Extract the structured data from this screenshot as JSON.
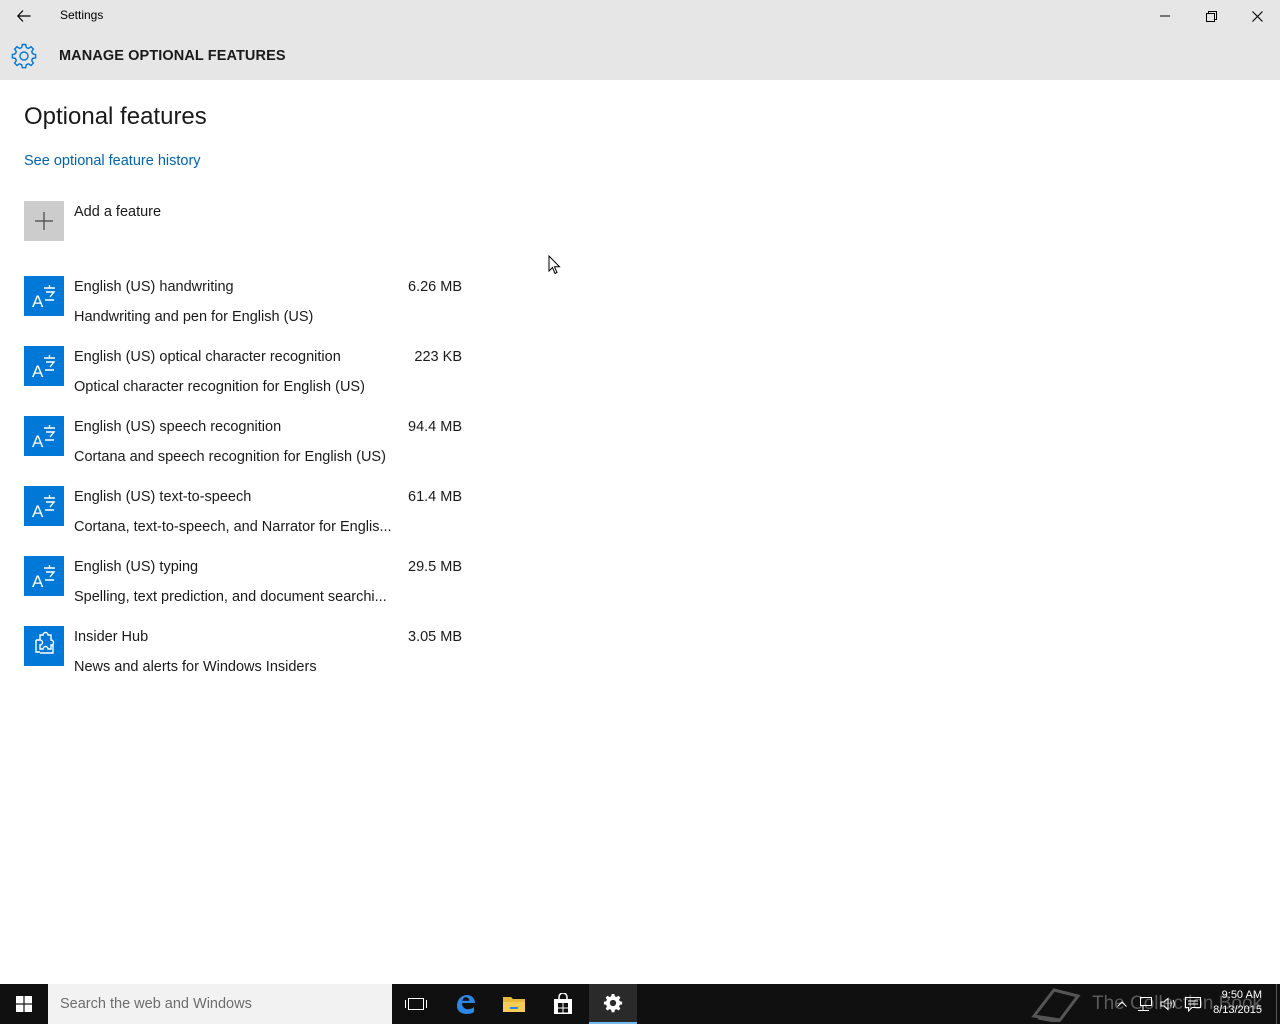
{
  "window": {
    "title": "Settings",
    "back_icon": "back-arrow-icon",
    "controls": [
      "minimize-icon",
      "restore-icon",
      "close-icon"
    ]
  },
  "header": {
    "title": "MANAGE OPTIONAL FEATURES",
    "icon": "gear-icon",
    "accent": "#0078d7"
  },
  "main": {
    "page_title": "Optional features",
    "history_link": "See optional feature history",
    "add_feature_label": "Add a feature",
    "link_color": "#0063b1",
    "features": [
      {
        "name": "English (US) handwriting",
        "description": "Handwriting and pen for English (US)",
        "size": "6.26 MB",
        "icon": "language-icon"
      },
      {
        "name": "English (US) optical character recognition",
        "description": "Optical character recognition for English (US)",
        "size": "223 KB",
        "icon": "language-icon"
      },
      {
        "name": "English (US) speech recognition",
        "description": "Cortana and speech recognition for English (US)",
        "size": "94.4 MB",
        "icon": "language-icon"
      },
      {
        "name": "English (US) text-to-speech",
        "description": "Cortana, text-to-speech, and Narrator for Englis...",
        "size": "61.4 MB",
        "icon": "language-icon"
      },
      {
        "name": "English (US) typing",
        "description": "Spelling, text prediction, and document searchi...",
        "size": "29.5 MB",
        "icon": "language-icon"
      },
      {
        "name": "Insider Hub",
        "description": "News and alerts for Windows Insiders",
        "size": "3.05 MB",
        "icon": "puzzle-icon"
      }
    ]
  },
  "taskbar": {
    "search_placeholder": "Search the web and Windows",
    "time": "9:50 AM",
    "date": "8/13/2015",
    "watermark": "The Collection Book"
  }
}
